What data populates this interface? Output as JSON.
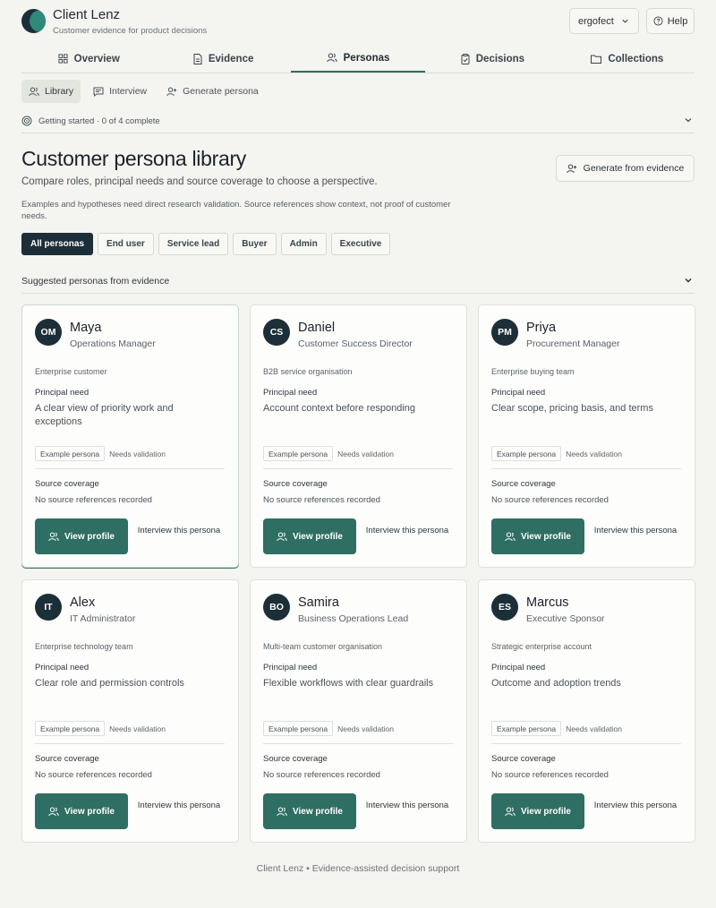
{
  "app": {
    "name": "Client Lenz",
    "tagline": "Customer evidence for product decisions",
    "workspace": "ergofect",
    "help_label": "Help"
  },
  "main_tabs": [
    {
      "label": "Overview",
      "icon": "grid-icon"
    },
    {
      "label": "Evidence",
      "icon": "document-icon"
    },
    {
      "label": "Personas",
      "icon": "users-icon",
      "active": true
    },
    {
      "label": "Decisions",
      "icon": "clipboard-icon"
    },
    {
      "label": "Collections",
      "icon": "folder-icon"
    }
  ],
  "sub_tabs": [
    {
      "label": "Library",
      "icon": "users-icon",
      "active": true
    },
    {
      "label": "Interview",
      "icon": "chat-icon"
    },
    {
      "label": "Generate persona",
      "icon": "user-plus-icon"
    }
  ],
  "progress": {
    "text": "Getting started · 0 of 4 complete"
  },
  "page": {
    "title": "Customer persona library",
    "subtitle": "Compare roles, principal needs and source coverage to choose a perspective.",
    "note": "Examples and hypotheses need direct research validation. Source references show context, not proof of customer needs.",
    "generate_label": "Generate from evidence"
  },
  "filters": [
    "All personas",
    "End user",
    "Service lead",
    "Buyer",
    "Admin",
    "Executive"
  ],
  "suggested_label": "Suggested personas from evidence",
  "card_labels": {
    "principal_need": "Principal need",
    "example_badge": "Example persona",
    "validation": "Needs validation",
    "source_coverage": "Source coverage",
    "no_sources": "No source references recorded",
    "view_profile": "View profile",
    "interview": "Interview this persona"
  },
  "personas": [
    {
      "initials": "OM",
      "name": "Maya",
      "role": "Operations Manager",
      "org": "Enterprise customer",
      "need": "A clear view of priority work and exceptions"
    },
    {
      "initials": "CS",
      "name": "Daniel",
      "role": "Customer Success Director",
      "org": "B2B service organisation",
      "need": "Account context before responding"
    },
    {
      "initials": "PM",
      "name": "Priya",
      "role": "Procurement Manager",
      "org": "Enterprise buying team",
      "need": "Clear scope, pricing basis, and terms"
    },
    {
      "initials": "IT",
      "name": "Alex",
      "role": "IT Administrator",
      "org": "Enterprise technology team",
      "need": "Clear role and permission controls"
    },
    {
      "initials": "BO",
      "name": "Samira",
      "role": "Business Operations Lead",
      "org": "Multi-team customer organisation",
      "need": "Flexible workflows with clear guardrails"
    },
    {
      "initials": "ES",
      "name": "Marcus",
      "role": "Executive Sponsor",
      "org": "Strategic enterprise account",
      "need": "Outcome and adoption trends"
    }
  ],
  "footer": "Client Lenz • Evidence-assisted decision support",
  "colors": {
    "accent": "#2f6e62",
    "navy": "#1c2e38",
    "background": "#f4f4f0"
  }
}
